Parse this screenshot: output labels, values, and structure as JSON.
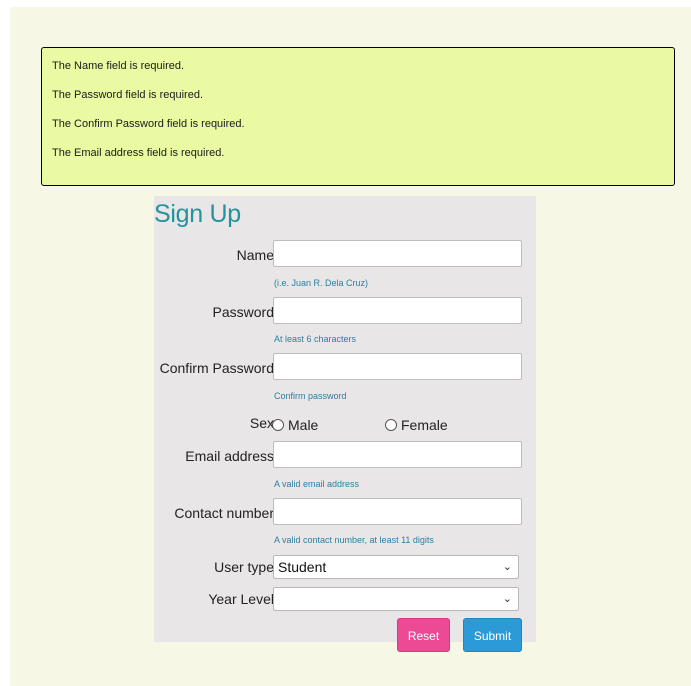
{
  "errors": [
    "The Name field is required.",
    "The Password field is required.",
    "The Confirm Password field is required.",
    "The Email address field is required."
  ],
  "form": {
    "title": "Sign Up",
    "name_label": "Name",
    "name_value": "",
    "name_hint": "(i.e. Juan R. Dela Cruz)",
    "password_label": "Password",
    "password_value": "",
    "password_hint": "At least 6 characters",
    "confirm_label": "Confirm Password",
    "confirm_value": "",
    "confirm_hint": "Confirm password",
    "sex_label": "Sex",
    "sex_options": [
      "Male",
      "Female"
    ],
    "email_label": "Email address",
    "email_value": "",
    "email_hint": "A valid email address",
    "contact_label": "Contact number",
    "contact_value": "",
    "contact_hint": "A valid contact number, at least 11 digits",
    "usertype_label": "User type",
    "usertype_value": "Student",
    "yearlevel_label": "Year Level",
    "yearlevel_value": "",
    "reset_label": "Reset",
    "submit_label": "Submit"
  },
  "colors": {
    "page_bg": "#f6f7e5",
    "error_bg": "#eafaa3",
    "panel_bg": "#e8e6e6",
    "title": "#25939b",
    "hint": "#2b7fa3",
    "reset_button": "#ec4a94",
    "submit_button": "#2b9ad6"
  }
}
